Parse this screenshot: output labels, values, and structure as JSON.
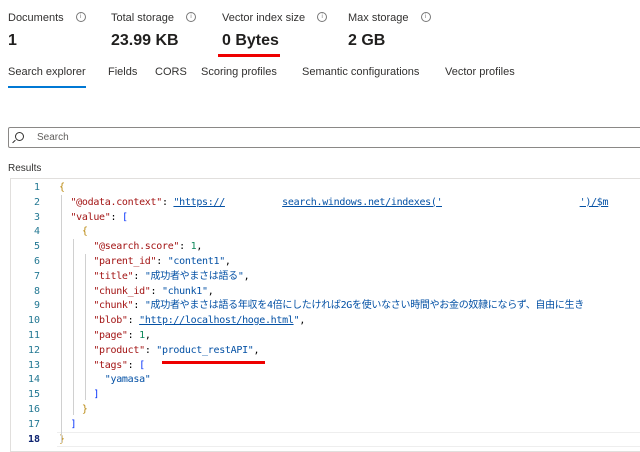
{
  "stats": [
    {
      "label": "Documents",
      "value": "1"
    },
    {
      "label": "Total storage",
      "value": "23.99 KB"
    },
    {
      "label": "Vector index size",
      "value": "0 Bytes"
    },
    {
      "label": "Max storage",
      "value": "2 GB"
    }
  ],
  "info_icon": "info-icon",
  "tabs": [
    "Search explorer",
    "Fields",
    "CORS",
    "Scoring profiles",
    "Semantic configurations",
    "Vector profiles"
  ],
  "active_tab": "Search explorer",
  "search": {
    "placeholder": "Search"
  },
  "results_label": "Results",
  "highlight_color": "#e00000",
  "accent_color": "#0078d4",
  "json_lines": [
    [
      [
        "b1",
        "{"
      ]
    ],
    [
      [
        "k",
        "  \"@odata.context\""
      ],
      [
        "p",
        ": "
      ],
      [
        "s u",
        "\"https://"
      ],
      [
        "blank",
        "          "
      ],
      [
        "s u",
        "search.windows.net/indexes('"
      ],
      [
        "blank",
        "                        "
      ],
      [
        "s u",
        "')/$m"
      ]
    ],
    [
      [
        "k",
        "  \"value\""
      ],
      [
        "p",
        ": "
      ],
      [
        "b2",
        "["
      ]
    ],
    [
      [
        "b1",
        "    {"
      ]
    ],
    [
      [
        "k",
        "      \"@search.score\""
      ],
      [
        "p",
        ": "
      ],
      [
        "n",
        "1"
      ],
      [
        "p",
        ","
      ]
    ],
    [
      [
        "k",
        "      \"parent_id\""
      ],
      [
        "p",
        ": "
      ],
      [
        "s",
        "\"content1\""
      ],
      [
        "p",
        ","
      ]
    ],
    [
      [
        "k",
        "      \"title\""
      ],
      [
        "p",
        ": "
      ],
      [
        "s",
        "\"成功者やまさは語る\""
      ],
      [
        "p",
        ","
      ]
    ],
    [
      [
        "k",
        "      \"chunk_id\""
      ],
      [
        "p",
        ": "
      ],
      [
        "s",
        "\"chunk1\""
      ],
      [
        "p",
        ","
      ]
    ],
    [
      [
        "k",
        "      \"chunk\""
      ],
      [
        "p",
        ": "
      ],
      [
        "s",
        "\"成功者やまさは語る年収を4倍にしたければ2Gを使いなさい時間やお金の奴隷にならず、自由に生き"
      ]
    ],
    [
      [
        "k",
        "      \"blob\""
      ],
      [
        "p",
        ": "
      ],
      [
        "s u",
        "\"http://localhost/hoge.html"
      ],
      [
        "s",
        "\""
      ],
      [
        "p",
        ","
      ]
    ],
    [
      [
        "k",
        "      \"page\""
      ],
      [
        "p",
        ": "
      ],
      [
        "n",
        "1"
      ],
      [
        "p",
        ","
      ]
    ],
    [
      [
        "k",
        "      \"product\""
      ],
      [
        "p",
        ": "
      ],
      [
        "s",
        "\"product_restAPI\""
      ],
      [
        "p",
        ","
      ]
    ],
    [
      [
        "k",
        "      \"tags\""
      ],
      [
        "p",
        ": "
      ],
      [
        "b2",
        "["
      ]
    ],
    [
      [
        "s",
        "        \"yamasa\""
      ]
    ],
    [
      [
        "b2",
        "      ]"
      ]
    ],
    [
      [
        "b1",
        "    }"
      ]
    ],
    [
      [
        "b2",
        "  ]"
      ]
    ],
    [
      [
        "b1",
        "}"
      ]
    ]
  ]
}
